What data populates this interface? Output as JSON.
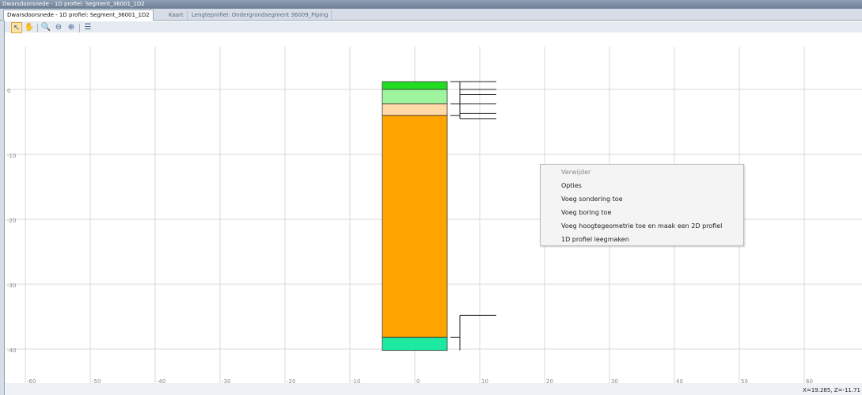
{
  "window": {
    "title": "Dwarsdoorsnede - 1D profiel: Segment_36001_1D2"
  },
  "tabs": [
    {
      "label": "Dwarsdoorsnede - 1D profiel: Segment_36001_1D2"
    },
    {
      "label": "Kaart"
    },
    {
      "label": "Lengteprofiel: Ondergrondsegment 36009_Piping"
    }
  ],
  "toolbar": {
    "icons": [
      "select-arrow-icon",
      "pan-hand-icon",
      "zoom-in-icon",
      "zoom-out-icon",
      "zoom-extent-icon",
      "legend-list-icon"
    ]
  },
  "chart_data": {
    "type": "soil-profile",
    "x_ticks": [
      "-60",
      "-50",
      "-40",
      "-30",
      "-20",
      "-10",
      "0",
      "10",
      "20",
      "30",
      "40",
      "50",
      "60"
    ],
    "y_ticks": [
      "0",
      "-10",
      "-20",
      "-30",
      "-40"
    ],
    "xlim": [
      -60,
      68
    ],
    "ylim": [
      -43,
      7
    ],
    "grid": true,
    "layers": [
      {
        "top": 1.2,
        "bottom": 0.0,
        "color": "#22dd22"
      },
      {
        "top": 0.0,
        "bottom": -2.2,
        "color": "#9ef59e"
      },
      {
        "top": -2.2,
        "bottom": -4.0,
        "color": "#ffd9a8"
      },
      {
        "top": -4.0,
        "bottom": -38.2,
        "color": "#ffa500"
      },
      {
        "top": -38.2,
        "bottom": -40.2,
        "color": "#1de9a0"
      }
    ],
    "column_x": [
      -5,
      5
    ]
  },
  "context_menu": {
    "items": [
      {
        "label": "Verwijder",
        "enabled": false
      },
      {
        "label": "Opties",
        "enabled": true
      },
      {
        "label": "Voeg sondering toe",
        "enabled": true
      },
      {
        "label": "Voeg boring toe",
        "enabled": true
      },
      {
        "label": "Voeg hoogtegeometrie toe en maak een 2D profiel",
        "enabled": true
      },
      {
        "label": "1D profiel leegmaken",
        "enabled": true
      }
    ]
  },
  "status": {
    "coordinates": "X=19.285, Z=-11.71"
  },
  "colors": {
    "accent": "#6b7e95",
    "grid": "#d9d9d9"
  }
}
